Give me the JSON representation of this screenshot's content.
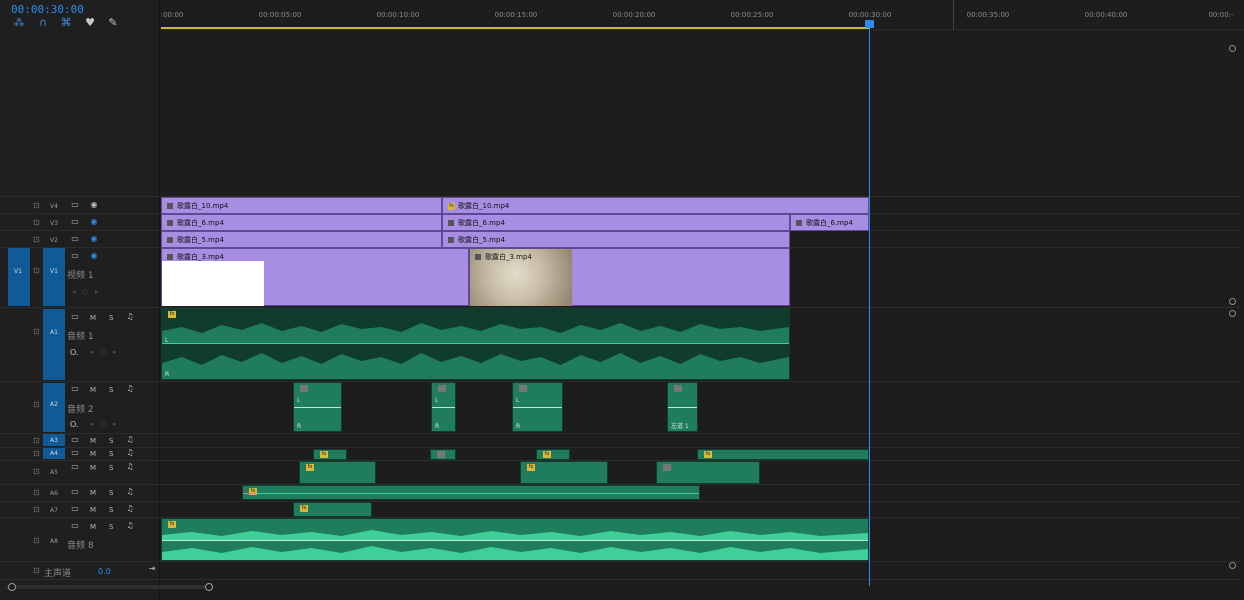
{
  "timecode": "00:00:30:00",
  "ruler": {
    "labels": [
      ":00:00",
      "00:00:05:00",
      "00:00:10:00",
      "00:00:15:00",
      "00:00:20:00",
      "00:00:25:00",
      "00:00:30:00",
      "00:00:35:00",
      "00:00:40:00",
      "00:00:-"
    ]
  },
  "tracks": {
    "v4": "V4",
    "v3": "V3",
    "v2": "V2",
    "v1": "V1",
    "v1_target": "V1",
    "v1_name": "视频 1",
    "a1": "A1",
    "a1_name": "音频 1",
    "a2": "A2",
    "a2_name": "音频 2",
    "a3": "A3",
    "a4": "A4",
    "a5": "A5",
    "a6": "A6",
    "a7": "A7",
    "a8": "A8",
    "a8_name": "音频 8",
    "mute": "M",
    "solo": "S",
    "vol_a1": "O.",
    "vol_a2": "O.",
    "master_name": "主声道",
    "master_value": "0.0"
  },
  "clips": {
    "v4_1": "歌露白_10.mp4",
    "v4_2": "歌露白_10.mp4",
    "v3_1": "歌露白_6.mp4",
    "v3_2": "歌露白_6.mp4",
    "v3_3": "歌露白_6.mp4",
    "v2_1": "歌露白_5.mp4",
    "v2_2": "歌露白_5.mp4",
    "v1_1": "歌露白_3.mp4",
    "v1_2": "歌露白_3.mp4",
    "a2_label": "左道 1",
    "a1_l": "L",
    "a1_r": "R",
    "a2_l": "L",
    "a2_r": "R",
    "fx": "fx"
  },
  "colors": {
    "accent": "#2d8ceb",
    "video_clip": "#a78ee2",
    "audio_clip": "#1f7c5d",
    "waveform": "#3fcf99",
    "work_area": "#c9b93a"
  }
}
